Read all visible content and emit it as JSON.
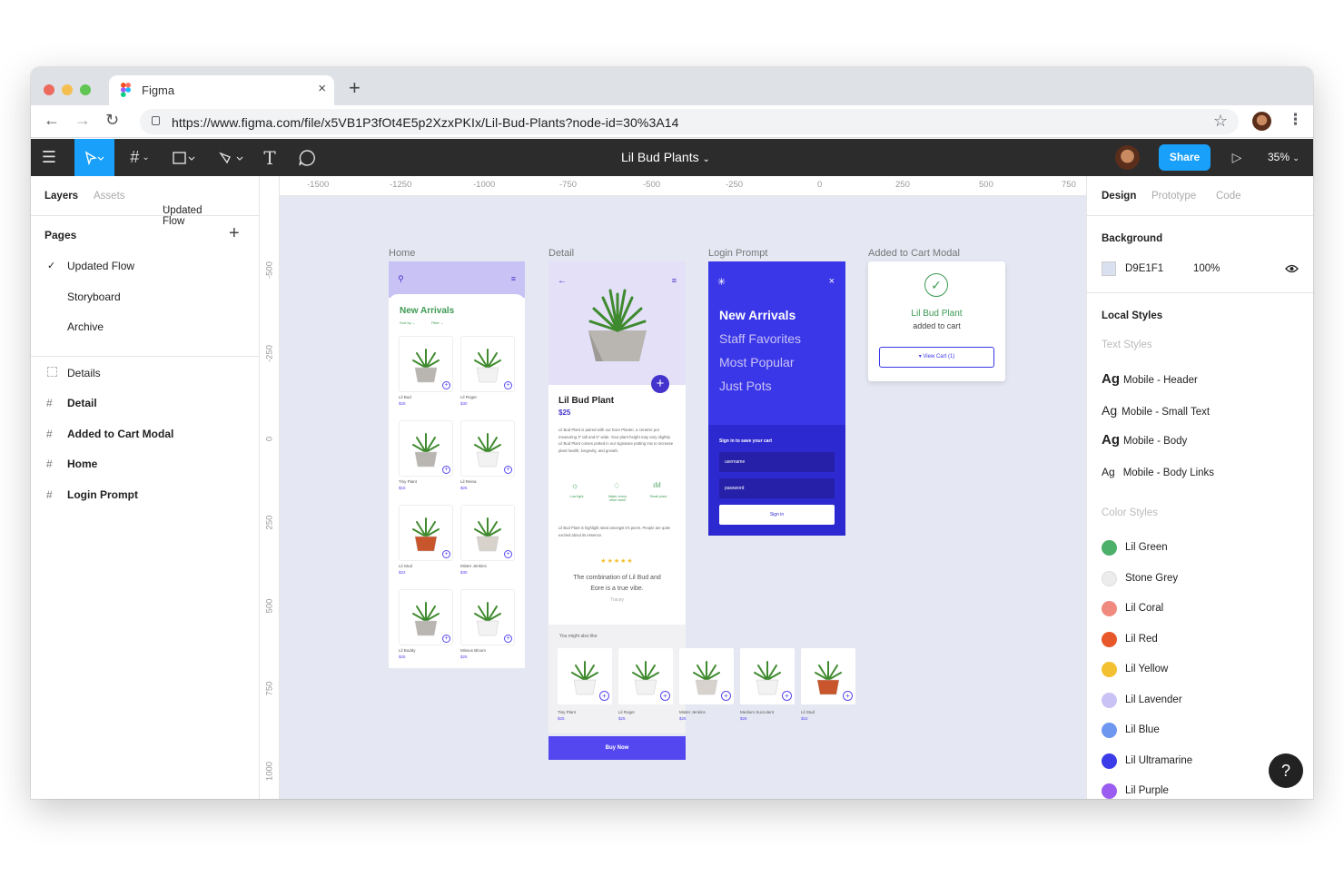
{
  "browser": {
    "tab_title": "Figma",
    "tab_close": "×",
    "new_tab": "+",
    "url": "https://www.figma.com/file/x5VB1P3fOt4E5p2XzxPKIx/Lil-Bud-Plants?node-id=30%3A14",
    "icons": [
      "back-icon",
      "forward-icon",
      "reload-icon",
      "lock-icon",
      "star-icon",
      "avatar",
      "more-icon"
    ]
  },
  "toolbar": {
    "file_title": "Lil Bud Plants",
    "share_label": "Share",
    "zoom": "35%"
  },
  "left_panel": {
    "tabs": [
      "Layers",
      "Assets",
      "Updated Flow"
    ],
    "pages_heading": "Pages",
    "pages": [
      "Updated Flow",
      "Storyboard",
      "Archive"
    ],
    "layers": [
      "Details",
      "Detail",
      "Added to Cart Modal",
      "Home",
      "Login Prompt"
    ]
  },
  "rulers": {
    "h": [
      "-1500",
      "-1250",
      "-1000",
      "-750",
      "-500",
      "-250",
      "0",
      "250",
      "500",
      "750"
    ],
    "v": [
      "-500",
      "-250",
      "0",
      "250",
      "500",
      "750",
      "1000"
    ]
  },
  "frames": {
    "home": {
      "label": "Home",
      "heading": "New Arrivals",
      "sort": "Sort by ⌄",
      "filter": "Filter ⌄",
      "products": [
        {
          "name": "Lil Bud",
          "price": "$25"
        },
        {
          "name": "Lil Roger",
          "price": "$30"
        },
        {
          "name": "Tiny Plant",
          "price": "$15"
        },
        {
          "name": "Lil Reina",
          "price": "$25"
        },
        {
          "name": "Lil Stud",
          "price": "$22"
        },
        {
          "name": "Mister Jenkins",
          "price": "$30"
        },
        {
          "name": "Lil Buddy",
          "price": "$25"
        },
        {
          "name": "Missus Bloom",
          "price": "$25"
        }
      ]
    },
    "detail": {
      "label": "Detail",
      "name": "Lil Bud Plant",
      "price": "$25",
      "desc": "Lil Bud Plant is paired with our Eore Planter, a ceramic pot measuring 3\" tall and 6\" wide. Your plant height may vary slightly. Lil Bud Plant comes potted in our signature potting mix to increase plant health, longevity, and growth.",
      "features": [
        "Low light",
        "Water every other week",
        "Small plant"
      ],
      "note": "Lil Bud Plant is highlight rated amongst it's peers. People are quite excited about its essence.",
      "stars": "★★★★★",
      "quote": "The combination of Lil Bud and Eore is a true vibe.",
      "author": "Tracey",
      "also_like": "You might also like",
      "suggestions": [
        {
          "name": "Tiny Plant",
          "price": "$25"
        },
        {
          "name": "Lil Roger",
          "price": "$25"
        },
        {
          "name": "Mister Jenkins",
          "price": "$25"
        },
        {
          "name": "Medium Succulent",
          "price": "$25"
        },
        {
          "name": "Lil Stud",
          "price": "$22"
        }
      ],
      "buy": "Buy Now"
    },
    "login": {
      "label": "Login Prompt",
      "items": [
        "New Arrivals",
        "Staff Favorites",
        "Most Popular",
        "Just Pots"
      ],
      "prompt": "Sign in to save your cart",
      "username": "username",
      "password": "password",
      "signin": "Sign in"
    },
    "modal": {
      "label": "Added to Cart Modal",
      "title": "Lil Bud Plant",
      "subtitle": "added to cart",
      "button": "View Cart (1)"
    }
  },
  "right_panel": {
    "tabs": [
      "Design",
      "Prototype",
      "Code"
    ],
    "background_heading": "Background",
    "bg_hex": "D9E1F1",
    "bg_opacity": "100%",
    "local_styles": "Local Styles",
    "text_styles_heading": "Text Styles",
    "text_styles": [
      "Mobile - Header",
      "Mobile - Small Text",
      "Mobile - Body",
      "Mobile - Body Links"
    ],
    "ag": "Ag",
    "color_styles_heading": "Color Styles",
    "colors": [
      {
        "name": "Lil Green",
        "hex": "#4caf6a"
      },
      {
        "name": "Stone Grey",
        "hex": "#ececec"
      },
      {
        "name": "Lil Coral",
        "hex": "#f08a7e"
      },
      {
        "name": "Lil Red",
        "hex": "#e8572a"
      },
      {
        "name": "Lil Yellow",
        "hex": "#f2c030"
      },
      {
        "name": "Lil Lavender",
        "hex": "#c9c2f5"
      },
      {
        "name": "Lil Blue",
        "hex": "#6e97f0"
      },
      {
        "name": "Lil Ultramarine",
        "hex": "#3b3be8"
      },
      {
        "name": "Lil Purple",
        "hex": "#9b5cf0"
      }
    ]
  },
  "help": "?"
}
